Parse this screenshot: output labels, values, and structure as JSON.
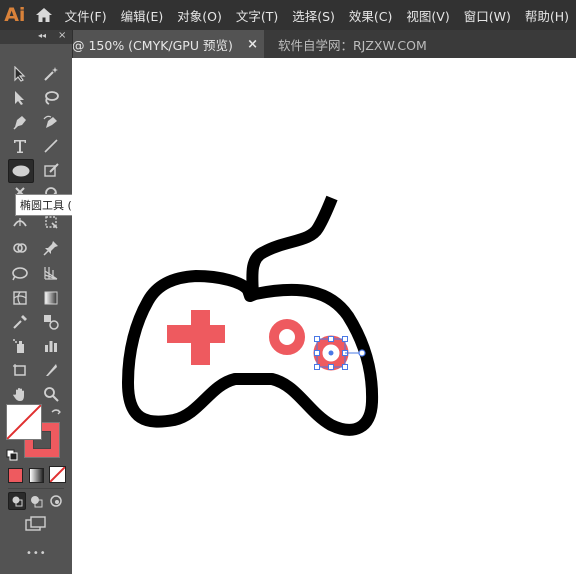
{
  "app": {
    "logo": "Ai"
  },
  "menubar": {
    "items": [
      "文件(F)",
      "编辑(E)",
      "对象(O)",
      "文字(T)",
      "选择(S)",
      "效果(C)",
      "视图(V)",
      "窗口(W)",
      "帮助(H)"
    ]
  },
  "tabs": {
    "active": "@ 150% (CMYK/GPU 预览)",
    "close": "×",
    "inactive": "软件自学网：RJZXW.COM"
  },
  "toolbar": {
    "collapse": "◂◂",
    "close": "×",
    "tooltip": "椭圆工具 (L)",
    "more": "•••"
  },
  "colors": {
    "accent": "#ee5a5f",
    "stroke": "#000000",
    "selection": "#4a78e6",
    "ui_dark": "#535353"
  }
}
